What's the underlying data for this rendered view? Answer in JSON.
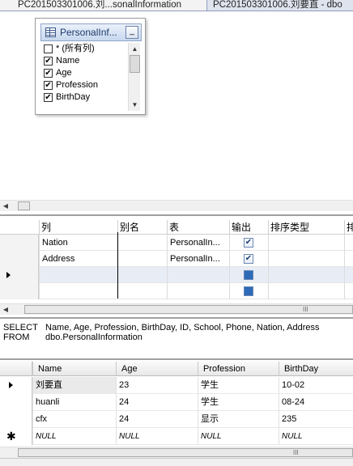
{
  "tabs": [
    {
      "label": "PC201503301006.刘...sonalInformation"
    },
    {
      "label": "PC201503301006.刘要直 - dbo"
    }
  ],
  "diagram": {
    "table_name": "PersonalInf...",
    "minimize_glyph": "_",
    "columns": [
      {
        "label": "* (所有列)",
        "checked": false
      },
      {
        "label": "Name",
        "checked": true
      },
      {
        "label": "Age",
        "checked": true
      },
      {
        "label": "Profession",
        "checked": true
      },
      {
        "label": "BirthDay",
        "checked": true
      }
    ]
  },
  "criteria": {
    "headers": [
      "列",
      "别名",
      "表",
      "输出",
      "排序类型",
      "排"
    ],
    "rows": [
      {
        "column": "Nation",
        "alias": "",
        "table": "PersonalIn...",
        "output": true
      },
      {
        "column": "Address",
        "alias": "",
        "table": "PersonalIn...",
        "output": true
      },
      {
        "column": "",
        "alias": "",
        "table": "",
        "output": false
      },
      {
        "column": "",
        "alias": "",
        "table": "",
        "output": false
      }
    ]
  },
  "sql": {
    "select_kw": "SELECT",
    "select_text": "Name, Age, Profession, BirthDay, ID, School, Phone, Nation, Address",
    "from_kw": "FROM",
    "from_text": "dbo.PersonalInformation"
  },
  "results": {
    "headers": [
      "Name",
      "Age",
      "Profession",
      "BirthDay"
    ],
    "rows": [
      [
        "刘要直",
        "23",
        "学生",
        "10-02"
      ],
      [
        "huanli",
        "24",
        "学生",
        "08-24"
      ],
      [
        "cfx",
        "24",
        "显示",
        "235"
      ],
      [
        "NULL",
        "NULL",
        "NULL",
        "NULL"
      ]
    ]
  },
  "scroll_grip": "III",
  "icons": {
    "checkbox_checked": "✔",
    "arrow_left": "◀",
    "arrow_right": "▶",
    "arrow_up": "▲",
    "arrow_down": "▼",
    "new_row": "✱"
  }
}
